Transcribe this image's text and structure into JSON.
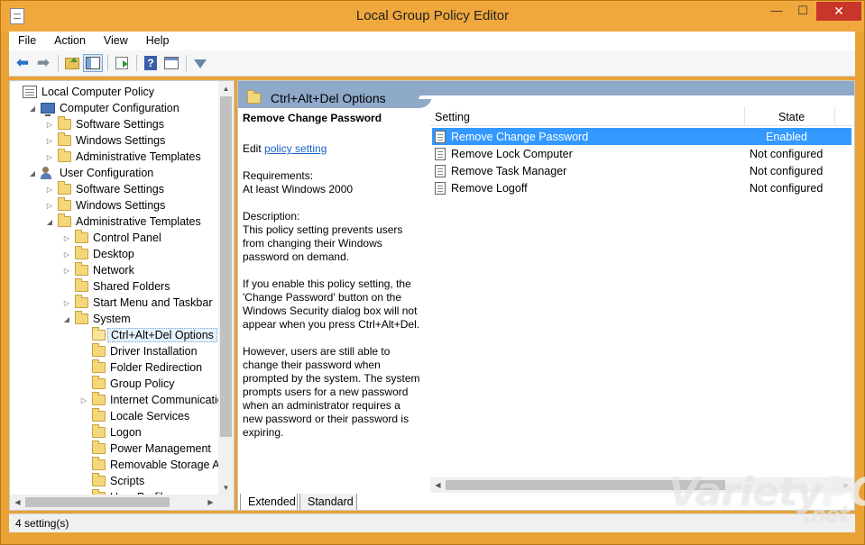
{
  "window": {
    "title": "Local Group Policy Editor"
  },
  "controls": {
    "minimize": "—",
    "maximize": "☐",
    "close": "✕"
  },
  "menu": [
    "File",
    "Action",
    "View",
    "Help"
  ],
  "toolbar": {
    "icons": [
      "back-arrow-icon",
      "forward-arrow-icon",
      "up-folder-icon",
      "show-hide-tree-icon",
      "export-list-icon",
      "help-icon",
      "properties-icon",
      "filter-icon"
    ]
  },
  "tree": {
    "items": [
      {
        "label": "Local Computer Policy",
        "icon": "policy-root-icon",
        "level": 0,
        "expander": ""
      },
      {
        "label": "Computer Configuration",
        "icon": "computer-icon",
        "level": 1,
        "expander": "◢"
      },
      {
        "label": "Software Settings",
        "icon": "folder-icon",
        "level": 2,
        "expander": "▷"
      },
      {
        "label": "Windows Settings",
        "icon": "folder-icon",
        "level": 2,
        "expander": "▷"
      },
      {
        "label": "Administrative Templates",
        "icon": "folder-icon",
        "level": 2,
        "expander": "▷"
      },
      {
        "label": "User Configuration",
        "icon": "users-icon",
        "level": 1,
        "expander": "◢"
      },
      {
        "label": "Software Settings",
        "icon": "folder-icon",
        "level": 2,
        "expander": "▷"
      },
      {
        "label": "Windows Settings",
        "icon": "folder-icon",
        "level": 2,
        "expander": "▷"
      },
      {
        "label": "Administrative Templates",
        "icon": "folder-icon",
        "level": 2,
        "expander": "◢"
      },
      {
        "label": "Control Panel",
        "icon": "folder-icon",
        "level": 3,
        "expander": "▷"
      },
      {
        "label": "Desktop",
        "icon": "folder-icon",
        "level": 3,
        "expander": "▷"
      },
      {
        "label": "Network",
        "icon": "folder-icon",
        "level": 3,
        "expander": "▷"
      },
      {
        "label": "Shared Folders",
        "icon": "folder-icon",
        "level": 3,
        "expander": ""
      },
      {
        "label": "Start Menu and Taskbar",
        "icon": "folder-icon",
        "level": 3,
        "expander": "▷"
      },
      {
        "label": "System",
        "icon": "folder-icon",
        "level": 3,
        "expander": "◢"
      },
      {
        "label": "Ctrl+Alt+Del Options",
        "icon": "folder-open-icon",
        "level": 4,
        "expander": "",
        "selected": true
      },
      {
        "label": "Driver Installation",
        "icon": "folder-icon",
        "level": 4,
        "expander": ""
      },
      {
        "label": "Folder Redirection",
        "icon": "folder-icon",
        "level": 4,
        "expander": ""
      },
      {
        "label": "Group Policy",
        "icon": "folder-icon",
        "level": 4,
        "expander": ""
      },
      {
        "label": "Internet Communicatic",
        "icon": "folder-icon",
        "level": 4,
        "expander": "▷"
      },
      {
        "label": "Locale Services",
        "icon": "folder-icon",
        "level": 4,
        "expander": ""
      },
      {
        "label": "Logon",
        "icon": "folder-icon",
        "level": 4,
        "expander": ""
      },
      {
        "label": "Power Management",
        "icon": "folder-icon",
        "level": 4,
        "expander": ""
      },
      {
        "label": "Removable Storage Acc",
        "icon": "folder-icon",
        "level": 4,
        "expander": ""
      },
      {
        "label": "Scripts",
        "icon": "folder-icon",
        "level": 4,
        "expander": ""
      },
      {
        "label": "User Profiles",
        "icon": "folder-icon",
        "level": 4,
        "expander": ""
      }
    ]
  },
  "details": {
    "header_title": "Ctrl+Alt+Del Options",
    "policy_title": "Remove Change Password",
    "edit_prefix": "Edit ",
    "edit_link": "policy setting ",
    "requirements_label": "Requirements:",
    "requirements_value": "At least Windows 2000",
    "description_label": "Description:",
    "description_1": "This policy setting prevents users from changing their Windows password on demand.",
    "description_2": "If you enable this policy setting, the 'Change Password' button on the Windows Security dialog box will not appear when you press Ctrl+Alt+Del.",
    "description_3": "However, users are still able to change their password when prompted by the system. The system prompts users for a new password when an administrator requires a new password or their password is expiring."
  },
  "list": {
    "col_setting": "Setting",
    "col_state": "State",
    "rows": [
      {
        "setting": "Remove Change Password",
        "state": "Enabled",
        "selected": true
      },
      {
        "setting": "Remove Lock Computer",
        "state": "Not configured",
        "selected": false
      },
      {
        "setting": "Remove Task Manager",
        "state": "Not configured",
        "selected": false
      },
      {
        "setting": "Remove Logoff",
        "state": "Not configured",
        "selected": false
      }
    ]
  },
  "tabs": {
    "extended": "Extended",
    "standard": "Standard"
  },
  "status": {
    "text": "4 setting(s)"
  },
  "watermark": {
    "main": "Variety",
    "accent": "PC",
    "suffix": ".net"
  },
  "colors": {
    "selection": "#3399ff",
    "header_band": "#8fa9c9",
    "titlebar": "#f0a83c",
    "close_button": "#c7352b"
  }
}
